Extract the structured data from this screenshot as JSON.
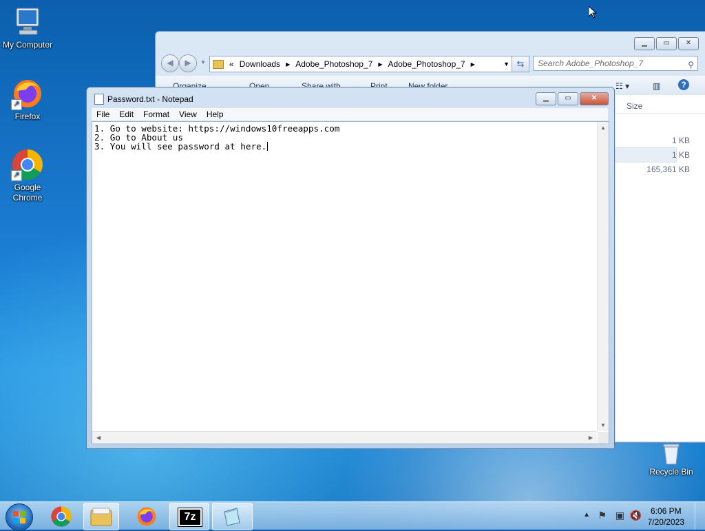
{
  "desktop": {
    "icons": [
      {
        "label": "My Computer"
      },
      {
        "label": "Firefox"
      },
      {
        "label": "Google Chrome"
      },
      {
        "label": "Recycle Bin"
      }
    ]
  },
  "explorer": {
    "breadcrumb": [
      "Downloads",
      "Adobe_Photoshop_7",
      "Adobe_Photoshop_7"
    ],
    "back_glyph": "«",
    "search_placeholder": "Search Adobe_Photoshop_7",
    "toolbar": [
      "Organize",
      "Open",
      "Share with",
      "Print",
      "New folder"
    ],
    "column_size": "Size",
    "sizes": [
      "1 KB",
      "1 KB",
      "165,361 KB"
    ]
  },
  "notepad": {
    "title": "Password.txt - Notepad",
    "menu": [
      "File",
      "Edit",
      "Format",
      "View",
      "Help"
    ],
    "lines": [
      "1. Go to website: https://windows10freeapps.com",
      "2. Go to About us",
      "3. You will see password at here."
    ]
  },
  "taskbar": {
    "time": "6:06 PM",
    "date": "7/20/2023",
    "sevenzip_label": "7z"
  },
  "colors": {
    "accent": "#1b7cd1",
    "close_button": "#c8553c"
  }
}
